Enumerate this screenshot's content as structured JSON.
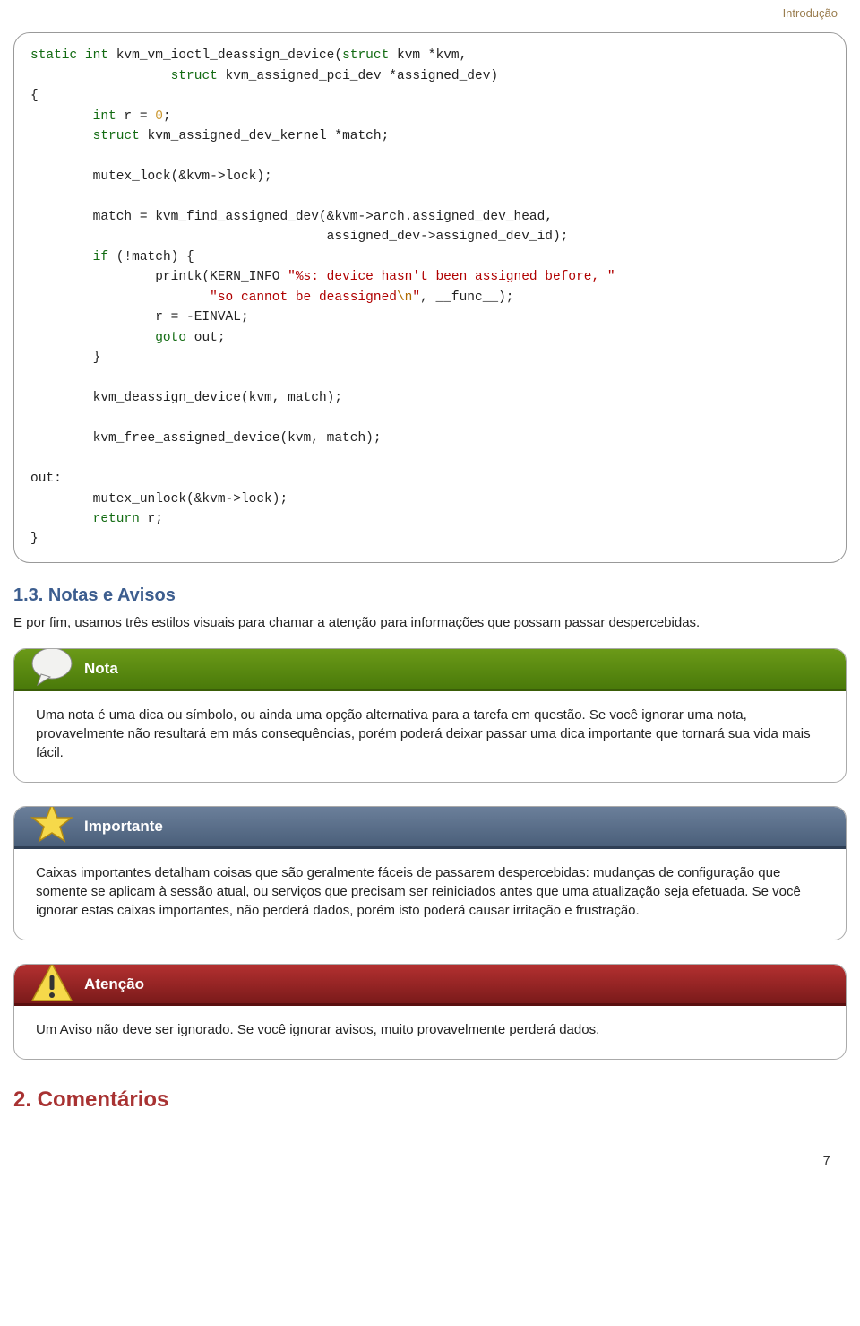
{
  "breadcrumb": "Introdução",
  "code": {
    "l01a": "static",
    "l01b": " int",
    "l01c": " kvm_vm_ioctl_deassign_device(",
    "l01d": "struct",
    "l01e": " kvm *kvm,",
    "l02a": "                  ",
    "l02b": "struct",
    "l02c": " kvm_assigned_pci_dev *assigned_dev)",
    "l03": "{",
    "l04a": "        ",
    "l04b": "int",
    "l04c": " r = ",
    "l04d": "0",
    "l04e": ";",
    "l05a": "        ",
    "l05b": "struct",
    "l05c": " kvm_assigned_dev_kernel *match;",
    "l06": "",
    "l07": "        mutex_lock(&kvm->lock);",
    "l08": "",
    "l09": "        match = kvm_find_assigned_dev(&kvm->arch.assigned_dev_head,",
    "l10": "                                      assigned_dev->assigned_dev_id);",
    "l11a": "        ",
    "l11b": "if",
    "l11c": " (!match) {",
    "l12a": "                printk(KERN_INFO ",
    "l12b": "\"%s: device hasn't been assigned before, \"",
    "l13a": "                       ",
    "l13b": "\"so cannot be deassigned",
    "l13c": "\\n",
    "l13d": "\"",
    "l13e": ", __func__);",
    "l14": "                r = -EINVAL;",
    "l15a": "                ",
    "l15b": "goto",
    "l15c": " out;",
    "l16": "        }",
    "l17": "",
    "l18": "        kvm_deassign_device(kvm, match);",
    "l19": "",
    "l20": "        kvm_free_assigned_device(kvm, match);",
    "l21": "",
    "l22": "out:",
    "l23": "        mutex_unlock(&kvm->lock);",
    "l24a": "        ",
    "l24b": "return",
    "l24c": " r;",
    "l25": "}"
  },
  "section": {
    "title": "1.3. Notas e Avisos",
    "intro": "E por fim, usamos três estilos visuais para chamar a atenção para informações que possam passar despercebidas."
  },
  "note": {
    "title": "Nota",
    "body": "Uma nota é uma dica ou símbolo, ou ainda uma opção alternativa para a tarefa em questão. Se você ignorar uma nota, provavelmente não resultará em más consequências, porém poderá deixar passar uma dica importante que tornará sua vida mais fácil."
  },
  "important": {
    "title": "Importante",
    "body": "Caixas importantes detalham coisas que são geralmente fáceis de passarem despercebidas: mudanças de configuração que somente se aplicam à sessão atual, ou serviços que precisam ser reiniciados antes que uma atualização seja efetuada. Se você ignorar estas caixas importantes, não perderá dados, porém isto poderá causar irritação e frustração."
  },
  "warning": {
    "title": "Atenção",
    "body": "Um Aviso não deve ser ignorado. Se você ignorar avisos, muito provavelmente perderá dados."
  },
  "chapter": "2. Comentários",
  "pagenum": "7"
}
